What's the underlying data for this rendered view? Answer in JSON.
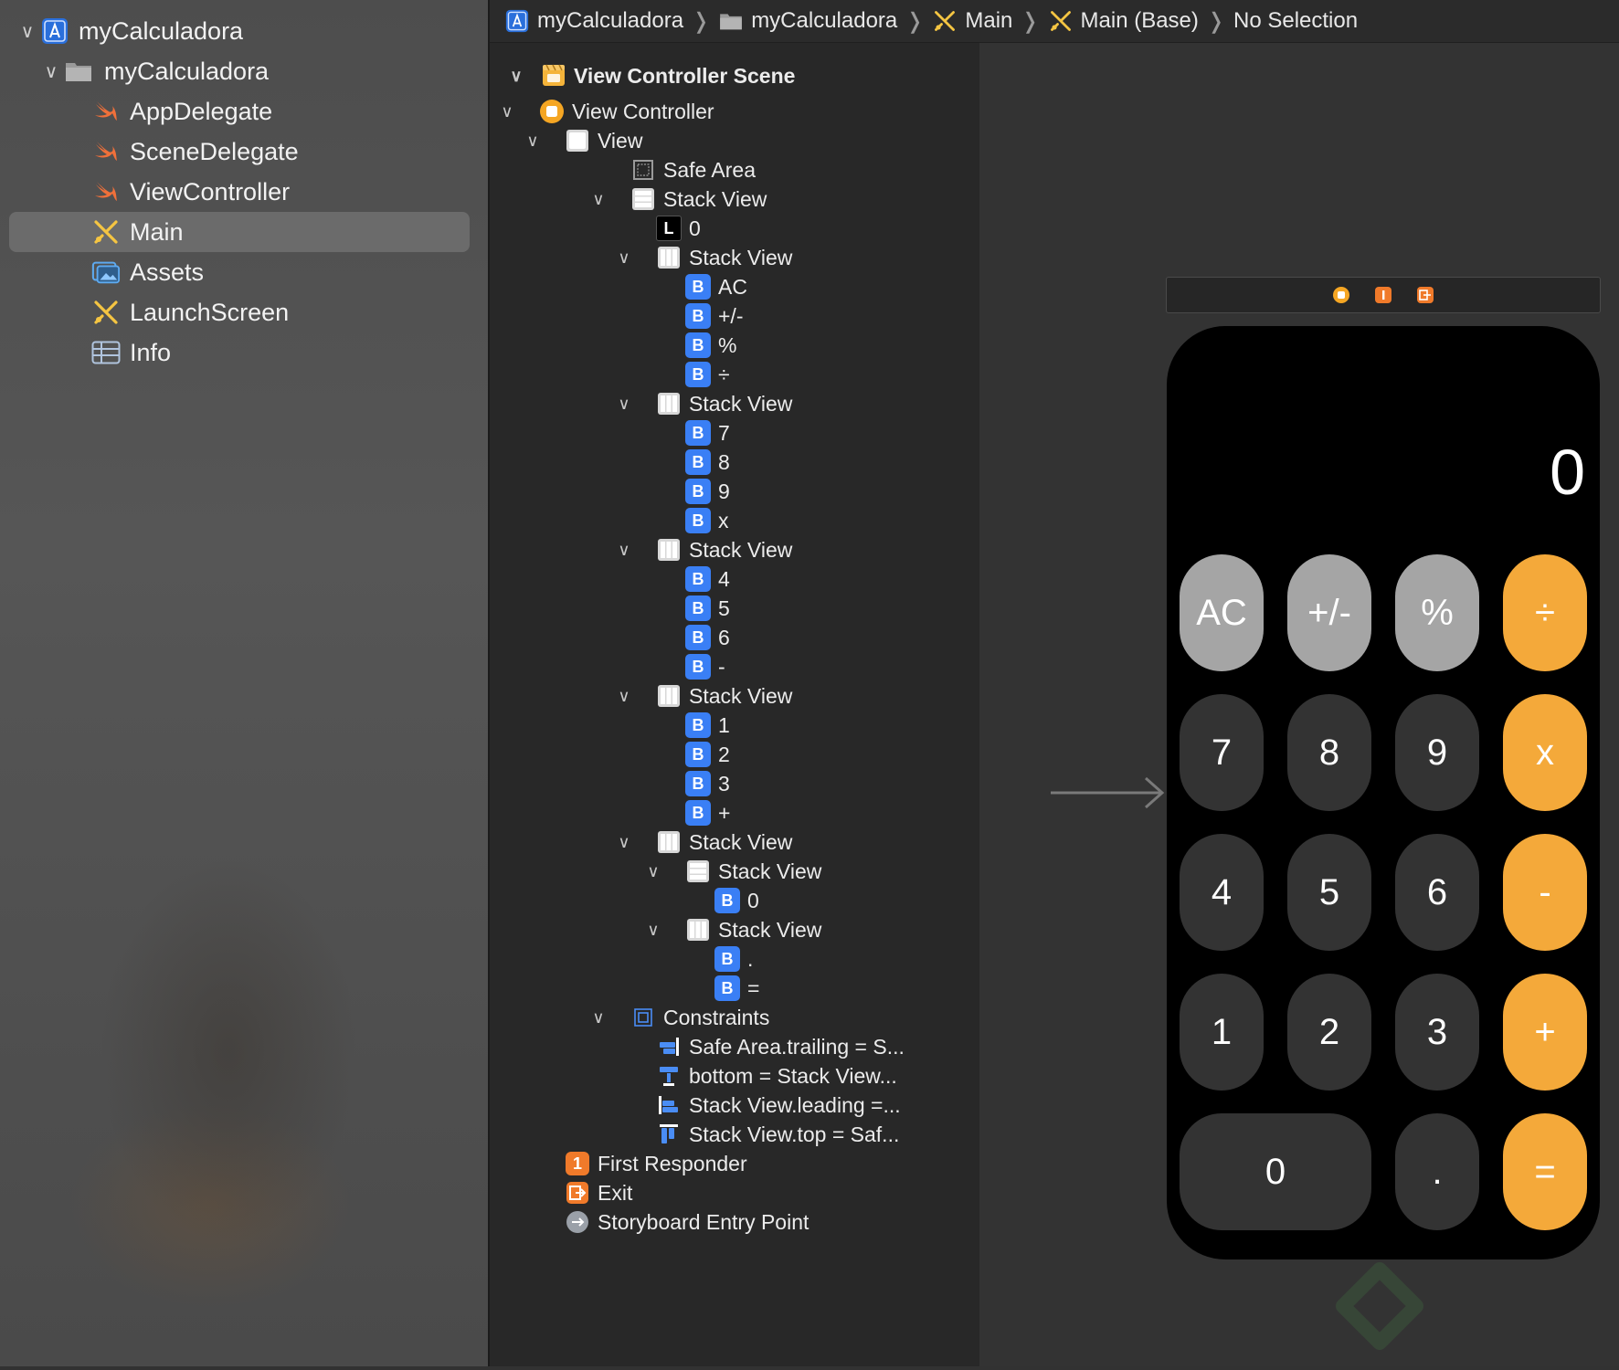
{
  "navigator": {
    "items": [
      {
        "label": "myCalculadora",
        "icon": "app-project-icon",
        "expanded": true
      },
      {
        "label": "myCalculadora",
        "icon": "folder-icon",
        "expanded": true
      },
      {
        "label": "AppDelegate",
        "icon": "swift-file-icon"
      },
      {
        "label": "SceneDelegate",
        "icon": "swift-file-icon"
      },
      {
        "label": "ViewController",
        "icon": "swift-file-icon"
      },
      {
        "label": "Main",
        "icon": "storyboard-icon",
        "selected": true
      },
      {
        "label": "Assets",
        "icon": "asset-catalog-icon"
      },
      {
        "label": "LaunchScreen",
        "icon": "storyboard-icon"
      },
      {
        "label": "Info",
        "icon": "plist-icon"
      }
    ]
  },
  "jumpbar": {
    "crumbs": [
      "myCalculadora",
      "myCalculadora",
      "Main",
      "Main (Base)",
      "No Selection"
    ]
  },
  "outline": {
    "rows": [
      "View Controller Scene",
      "View Controller",
      "View",
      "Safe Area",
      "Stack View",
      "L",
      "0",
      "Stack View",
      "B",
      "AC",
      "+/-",
      "%",
      "÷",
      "Stack View",
      "7",
      "8",
      "9",
      "x",
      "Stack View",
      "4",
      "5",
      "6",
      "-",
      "Stack View",
      "1",
      "2",
      "3",
      "+",
      "Stack View",
      "Stack View",
      "0",
      "Stack View",
      ".",
      "=",
      "Constraints",
      "Safe Area.trailing = S...",
      "bottom = Stack View...",
      "Stack View.leading =...",
      "Stack View.top = Saf...",
      "1",
      "First Responder",
      "Exit",
      "Storyboard Entry Point"
    ]
  },
  "calculator": {
    "display": "0",
    "rows": [
      [
        {
          "label": "AC",
          "style": "gray"
        },
        {
          "label": "+/-",
          "style": "gray"
        },
        {
          "label": "%",
          "style": "gray"
        },
        {
          "label": "÷",
          "style": "orange"
        }
      ],
      [
        {
          "label": "7",
          "style": "dark"
        },
        {
          "label": "8",
          "style": "dark"
        },
        {
          "label": "9",
          "style": "dark"
        },
        {
          "label": "x",
          "style": "orange"
        }
      ],
      [
        {
          "label": "4",
          "style": "dark"
        },
        {
          "label": "5",
          "style": "dark"
        },
        {
          "label": "6",
          "style": "dark"
        },
        {
          "label": "-",
          "style": "orange"
        }
      ],
      [
        {
          "label": "1",
          "style": "dark"
        },
        {
          "label": "2",
          "style": "dark"
        },
        {
          "label": "3",
          "style": "dark"
        },
        {
          "label": "+",
          "style": "orange"
        }
      ],
      [
        {
          "label": "0",
          "style": "dark"
        },
        {
          "label": ".",
          "style": "dark"
        },
        {
          "label": "=",
          "style": "orange"
        }
      ]
    ]
  },
  "colors": {
    "accent_blue": "#3a7ff5",
    "calc_orange": "#f4a93a",
    "calc_gray": "#a5a5a5",
    "calc_dark": "#333333",
    "swift_orange": "#f0703a"
  }
}
